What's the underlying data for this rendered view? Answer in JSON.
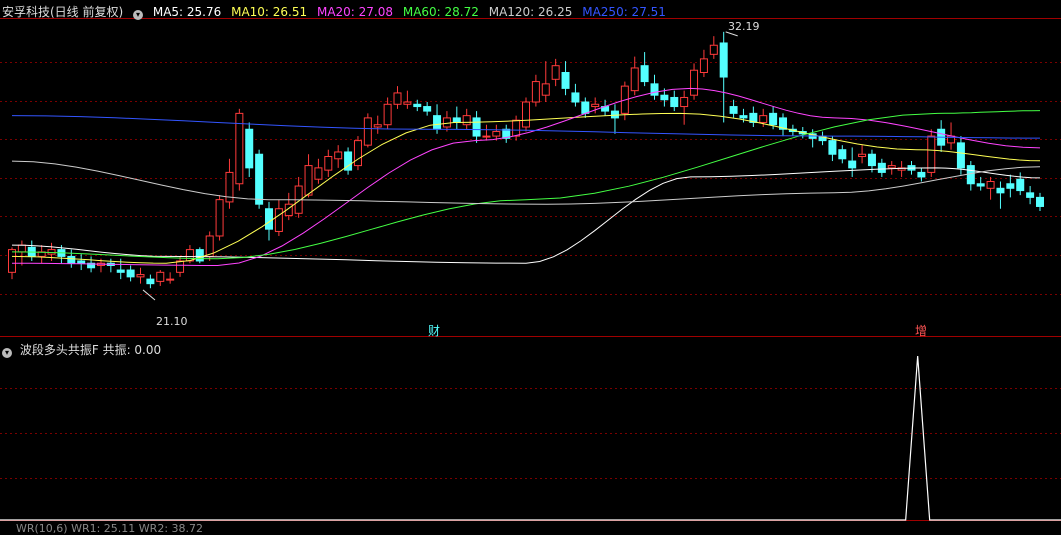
{
  "header": {
    "stock_title": "安孚科技(日线 前复权)",
    "ma_items": [
      {
        "label": "MA5: 25.76",
        "color": "#ffffff"
      },
      {
        "label": "MA10: 26.51",
        "color": "#ffff55"
      },
      {
        "label": "MA20: 27.08",
        "color": "#ff44ff"
      },
      {
        "label": "MA60: 28.72",
        "color": "#44ff44"
      },
      {
        "label": "MA120: 26.25",
        "color": "#cccccc"
      },
      {
        "label": "MA250: 27.51",
        "color": "#3355ff"
      }
    ]
  },
  "annotations": {
    "high_label": "32.19",
    "low_label": "21.10",
    "marker_cai": "财",
    "marker_zeng": "增"
  },
  "indicator": {
    "title": "波段多头共振F",
    "value_label": "共振: 0.00"
  },
  "bottom_truncated": "WR(10,6) WR1: 25.11 WR2: 38.72",
  "colors": {
    "up": "#ff3b3b",
    "down": "#54ffff",
    "grid": "#7a0000",
    "frame": "#a00000"
  },
  "chart_data": {
    "type": "candlestick",
    "y_range": [
      19.5,
      32.8
    ],
    "candles": [
      [
        21.6,
        22.6,
        21.3,
        22.7
      ],
      [
        22.5,
        22.8,
        21.9,
        23.0
      ],
      [
        22.7,
        22.3,
        22.1,
        23.0
      ],
      [
        22.3,
        22.5,
        22.0,
        22.8
      ],
      [
        22.4,
        22.6,
        22.1,
        22.9
      ],
      [
        22.6,
        22.3,
        22.0,
        22.8
      ],
      [
        22.3,
        22.0,
        21.8,
        22.6
      ],
      [
        22.1,
        22.0,
        21.7,
        22.4
      ],
      [
        22.0,
        21.8,
        21.6,
        22.3
      ],
      [
        21.9,
        22.0,
        21.6,
        22.2
      ],
      [
        22.0,
        21.9,
        21.6,
        22.2
      ],
      [
        21.7,
        21.6,
        21.3,
        22.2
      ],
      [
        21.7,
        21.4,
        21.2,
        21.9
      ],
      [
        21.4,
        21.5,
        21.1,
        21.8
      ],
      [
        21.3,
        21.1,
        20.9,
        21.5
      ],
      [
        21.2,
        21.6,
        21.0,
        21.7
      ],
      [
        21.3,
        21.3,
        21.1,
        21.6
      ],
      [
        21.6,
        22.1,
        21.4,
        22.3
      ],
      [
        22.1,
        22.6,
        22.0,
        22.8
      ],
      [
        22.6,
        22.1,
        22.0,
        22.7
      ],
      [
        22.3,
        23.2,
        22.1,
        23.4
      ],
      [
        23.2,
        24.8,
        23.0,
        25.0
      ],
      [
        24.7,
        26.0,
        24.4,
        26.6
      ],
      [
        25.5,
        28.6,
        25.2,
        28.8
      ],
      [
        27.9,
        26.2,
        25.8,
        28.2
      ],
      [
        26.8,
        24.6,
        24.4,
        27.0
      ],
      [
        24.4,
        23.5,
        23.0,
        24.7
      ],
      [
        23.4,
        24.4,
        23.2,
        24.8
      ],
      [
        24.1,
        24.6,
        23.9,
        25.1
      ],
      [
        24.2,
        25.4,
        24.0,
        25.8
      ],
      [
        25.0,
        26.3,
        24.9,
        26.8
      ],
      [
        25.7,
        26.2,
        25.5,
        26.6
      ],
      [
        26.1,
        26.7,
        25.8,
        27.0
      ],
      [
        26.6,
        26.9,
        26.2,
        27.2
      ],
      [
        26.9,
        26.1,
        25.9,
        27.1
      ],
      [
        26.3,
        27.4,
        26.1,
        27.6
      ],
      [
        27.2,
        28.4,
        27.1,
        28.6
      ],
      [
        28.0,
        28.1,
        27.7,
        28.5
      ],
      [
        28.1,
        29.0,
        27.9,
        29.3
      ],
      [
        29.0,
        29.5,
        28.8,
        29.8
      ],
      [
        29.0,
        29.1,
        28.8,
        29.6
      ],
      [
        29.0,
        28.9,
        28.7,
        29.2
      ],
      [
        28.9,
        28.7,
        28.5,
        29.1
      ],
      [
        28.5,
        27.9,
        27.7,
        29.0
      ],
      [
        28.0,
        28.4,
        27.8,
        28.7
      ],
      [
        28.4,
        28.2,
        27.9,
        28.9
      ],
      [
        28.1,
        28.5,
        27.9,
        28.8
      ],
      [
        28.4,
        27.6,
        27.3,
        28.7
      ],
      [
        27.6,
        27.6,
        27.4,
        28.1
      ],
      [
        27.6,
        27.8,
        27.4,
        28.1
      ],
      [
        27.9,
        27.5,
        27.3,
        28.1
      ],
      [
        27.6,
        28.3,
        27.4,
        28.5
      ],
      [
        28.0,
        29.1,
        27.8,
        29.3
      ],
      [
        29.1,
        30.0,
        28.9,
        30.3
      ],
      [
        29.4,
        29.9,
        29.1,
        30.9
      ],
      [
        30.1,
        30.7,
        29.8,
        31.0
      ],
      [
        30.4,
        29.7,
        29.4,
        30.9
      ],
      [
        29.5,
        29.1,
        28.9,
        29.9
      ],
      [
        29.1,
        28.6,
        28.4,
        29.3
      ],
      [
        28.9,
        29.0,
        28.6,
        29.3
      ],
      [
        28.9,
        28.7,
        28.5,
        29.2
      ],
      [
        28.7,
        28.4,
        27.7,
        29.0
      ],
      [
        28.6,
        29.8,
        28.3,
        30.0
      ],
      [
        29.6,
        30.6,
        29.4,
        31.1
      ],
      [
        30.7,
        30.0,
        29.8,
        31.3
      ],
      [
        29.9,
        29.4,
        29.2,
        30.3
      ],
      [
        29.4,
        29.2,
        28.9,
        29.7
      ],
      [
        29.3,
        28.9,
        28.7,
        29.6
      ],
      [
        28.9,
        29.3,
        28.1,
        29.6
      ],
      [
        29.4,
        30.5,
        29.2,
        30.8
      ],
      [
        30.4,
        31.0,
        30.2,
        31.4
      ],
      [
        31.2,
        31.6,
        31.0,
        32.0
      ],
      [
        31.7,
        30.2,
        28.2,
        32.19
      ],
      [
        28.9,
        28.6,
        28.4,
        29.2
      ],
      [
        28.5,
        28.4,
        28.2,
        28.8
      ],
      [
        28.6,
        28.2,
        28.0,
        28.9
      ],
      [
        28.2,
        28.5,
        28.0,
        28.8
      ],
      [
        28.6,
        28.1,
        27.9,
        28.9
      ],
      [
        28.4,
        27.9,
        27.6,
        28.6
      ],
      [
        27.9,
        27.8,
        27.6,
        28.1
      ],
      [
        27.8,
        27.7,
        27.5,
        28.0
      ],
      [
        27.7,
        27.5,
        27.1,
        27.9
      ],
      [
        27.6,
        27.4,
        27.2,
        27.8
      ],
      [
        27.4,
        26.8,
        26.5,
        27.6
      ],
      [
        27.0,
        26.6,
        26.4,
        27.2
      ],
      [
        26.5,
        26.2,
        25.8,
        27.1
      ],
      [
        26.7,
        26.8,
        26.4,
        27.2
      ],
      [
        26.8,
        26.3,
        26.0,
        27.0
      ],
      [
        26.4,
        26.0,
        25.8,
        26.6
      ],
      [
        26.2,
        26.3,
        25.9,
        26.5
      ],
      [
        26.1,
        26.2,
        25.8,
        26.5
      ],
      [
        26.3,
        26.1,
        25.9,
        26.5
      ],
      [
        26.0,
        25.8,
        25.6,
        26.2
      ],
      [
        26.0,
        27.6,
        25.8,
        27.9
      ],
      [
        27.9,
        27.2,
        26.9,
        28.3
      ],
      [
        27.3,
        27.6,
        27.0,
        28.2
      ],
      [
        27.3,
        26.2,
        25.9,
        27.6
      ],
      [
        26.3,
        25.5,
        25.2,
        26.5
      ],
      [
        25.5,
        25.4,
        25.2,
        25.8
      ],
      [
        25.3,
        25.6,
        24.8,
        25.8
      ],
      [
        25.3,
        25.1,
        24.4,
        25.6
      ],
      [
        25.5,
        25.3,
        24.9,
        25.9
      ],
      [
        25.7,
        25.2,
        25.0,
        26.0
      ],
      [
        25.1,
        24.9,
        24.6,
        25.4
      ],
      [
        24.9,
        24.5,
        24.3,
        25.1
      ]
    ],
    "ma_lines": [
      {
        "name": "MA5",
        "color": "#ffffff",
        "values": [
          [
            0,
            22.8
          ],
          [
            0.15,
            22.3
          ],
          [
            0.5,
            22.0
          ],
          [
            0.66,
            25.8
          ],
          [
            0.9,
            26.2
          ],
          [
            1.0,
            25.76
          ]
        ]
      },
      {
        "name": "MA10",
        "color": "#ffff55",
        "values": [
          [
            0,
            22.3
          ],
          [
            0.15,
            22.0
          ],
          [
            0.43,
            28.2
          ],
          [
            0.65,
            28.6
          ],
          [
            0.88,
            27.0
          ],
          [
            1.0,
            26.51
          ]
        ]
      },
      {
        "name": "MA20",
        "color": "#ff44ff",
        "values": [
          [
            0,
            22.0
          ],
          [
            0.2,
            21.9
          ],
          [
            0.45,
            27.4
          ],
          [
            0.66,
            29.7
          ],
          [
            0.8,
            28.4
          ],
          [
            1.0,
            27.08
          ]
        ]
      },
      {
        "name": "MA60",
        "color": "#44ff44",
        "values": [
          [
            0,
            22.5
          ],
          [
            0.2,
            22.2
          ],
          [
            0.5,
            24.8
          ],
          [
            0.9,
            28.6
          ],
          [
            1.0,
            28.72
          ]
        ]
      },
      {
        "name": "MA120",
        "color": "#cccccc",
        "values": [
          [
            0,
            26.5
          ],
          [
            0.25,
            24.8
          ],
          [
            0.52,
            24.6
          ],
          [
            0.8,
            25.1
          ],
          [
            1.0,
            26.25
          ]
        ]
      },
      {
        "name": "MA250",
        "color": "#3355ff",
        "values": [
          [
            0,
            28.5
          ],
          [
            0.4,
            27.9
          ],
          [
            0.8,
            27.6
          ],
          [
            1.0,
            27.51
          ]
        ]
      }
    ],
    "indicator_series": {
      "name": "共振",
      "range": [
        0,
        1
      ],
      "spike_at": 0.881,
      "value": 0.0
    }
  }
}
